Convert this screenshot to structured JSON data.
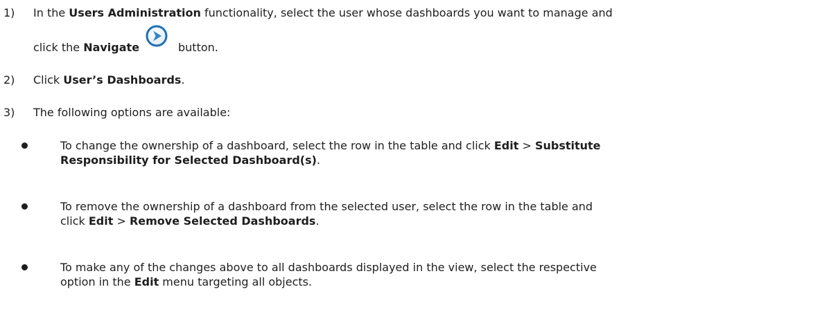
{
  "steps": [
    {
      "number": "1)",
      "line1_prefix": "In the ",
      "line1_bold": "Users Administration",
      "line1_suffix": " functionality, select the user whose dashboards you want to manage and",
      "line2_prefix": "click the ",
      "line2_bold": "Navigate",
      "line2_suffix": "button.",
      "icon": "navigate-arrow-icon"
    },
    {
      "number": "2)",
      "prefix": "Click ",
      "bold": "User’s Dashboards",
      "suffix": "."
    },
    {
      "number": "3)",
      "text": "The following options are available:"
    }
  ],
  "bullets": [
    {
      "line1_prefix": "To change the ownership of a dashboard, select the row in the table and click ",
      "line1_bold1": "Edit",
      "line1_sep": " > ",
      "line1_bold2": "Substitute",
      "line2_bold": "Responsibility for Selected Dashboard(s)",
      "line2_suffix": "."
    },
    {
      "line1": "To remove the ownership of a dashboard from the selected user, select the row in the table and",
      "line2_prefix": "click ",
      "line2_bold1": "Edit",
      "line2_sep": " > ",
      "line2_bold2": "Remove Selected Dashboards",
      "line2_suffix": "."
    },
    {
      "line1": "To make any of the changes above to all dashboards displayed in the view, select the respective",
      "line2_prefix": "option in the ",
      "line2_bold": "Edit",
      "line2_suffix": " menu targeting all objects."
    }
  ],
  "colors": {
    "text": "#1e1e1e",
    "icon_ring": "#1f6fb2",
    "icon_fill": "#2f86cc"
  }
}
